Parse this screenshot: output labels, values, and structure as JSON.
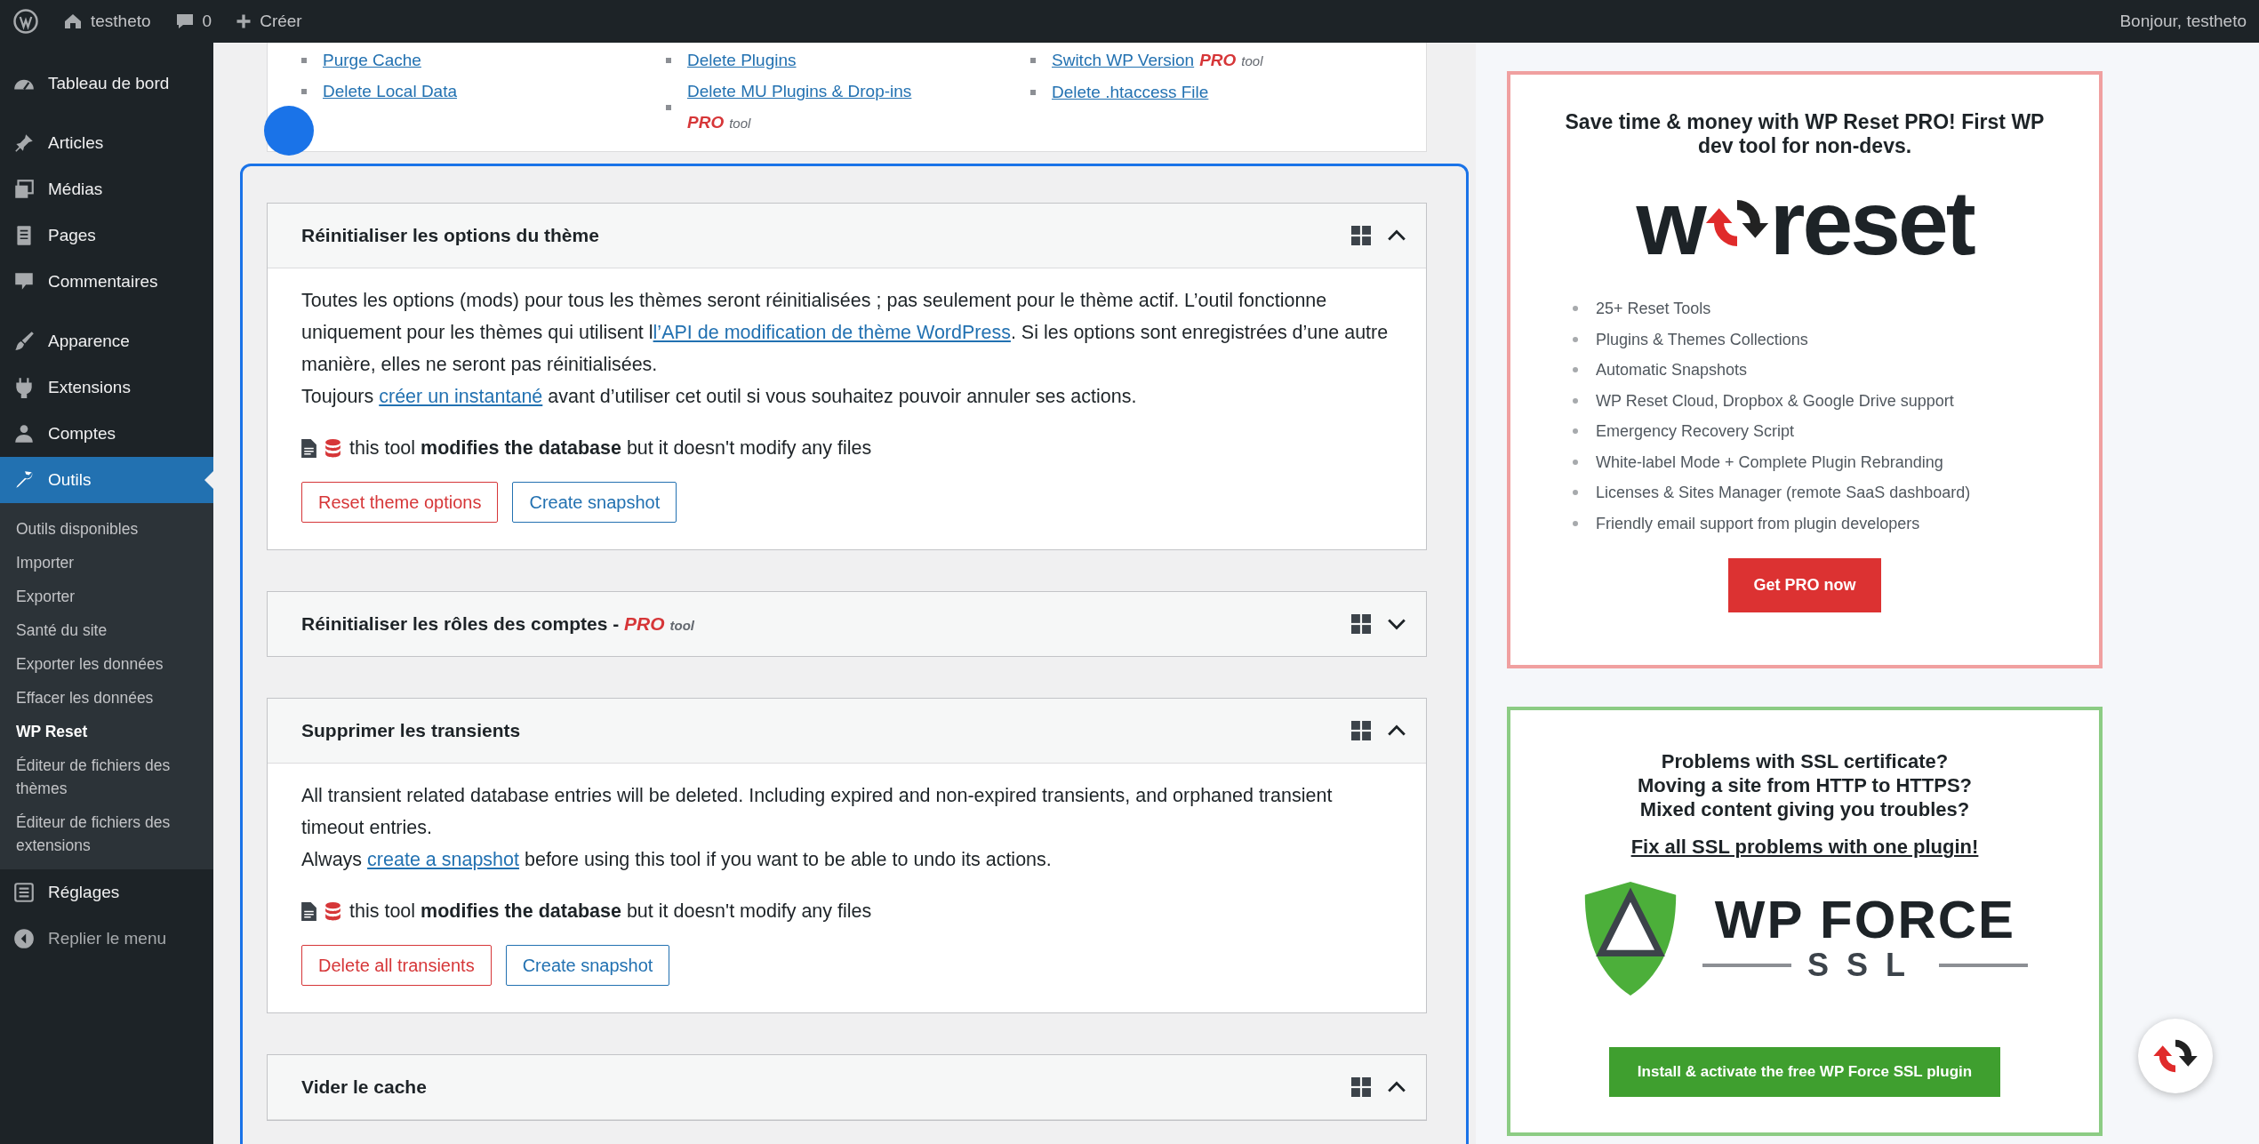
{
  "admin_bar": {
    "site": "testheto",
    "comments": "0",
    "new": "Créer",
    "greeting": "Bonjour, testheto"
  },
  "sidebar": {
    "items": [
      {
        "label": "Tableau de bord",
        "selected": false
      },
      {
        "label": "Articles",
        "selected": false
      },
      {
        "label": "Médias",
        "selected": false
      },
      {
        "label": "Pages",
        "selected": false
      },
      {
        "label": "Commentaires",
        "selected": false
      },
      {
        "label": "Apparence",
        "selected": false
      },
      {
        "label": "Extensions",
        "selected": false
      },
      {
        "label": "Comptes",
        "selected": false
      },
      {
        "label": "Outils",
        "selected": true,
        "children": [
          {
            "label": "Outils disponibles",
            "selected": false
          },
          {
            "label": "Importer",
            "selected": false
          },
          {
            "label": "Exporter",
            "selected": false
          },
          {
            "label": "Santé du site",
            "selected": false
          },
          {
            "label": "Exporter les données",
            "selected": false
          },
          {
            "label": "Effacer les données",
            "selected": false
          },
          {
            "label": "WP Reset",
            "selected": true
          },
          {
            "label": "Éditeur de fichiers des thèmes",
            "selected": false
          },
          {
            "label": "Éditeur de fichiers des extensions",
            "selected": false
          }
        ]
      },
      {
        "label": "Réglages",
        "selected": false
      }
    ],
    "collapse_label": "Replier le menu"
  },
  "tools_list": {
    "columns": [
      [
        {
          "label": "Purge Cache"
        },
        {
          "label": "Delete Local Data"
        }
      ],
      [
        {
          "label": "Delete Plugins"
        },
        {
          "label": "Delete MU Plugins & Drop-ins",
          "pro": "PRO",
          "pro_note": "tool"
        }
      ],
      [
        {
          "label": "Switch WP Version",
          "pro": "PRO",
          "pro_note": "tool"
        },
        {
          "label": "Delete .htaccess File"
        }
      ]
    ]
  },
  "cards": [
    {
      "title": "Réinitialiser les options du thème",
      "expanded": true,
      "paragraphs": [
        [
          {
            "kind": "text",
            "text": "Toutes les options (mods) pour tous les thèmes seront réinitialisées ; pas seulement pour le thème actif. L’outil fonctionne uniquement pour les thèmes qui utilisent l"
          },
          {
            "kind": "link",
            "text": "l’API de modification de thème WordPress"
          },
          {
            "kind": "text",
            "text": ". Si les options sont enregistrées d’une autre manière, elles ne seront pas réinitialisées."
          }
        ],
        [
          {
            "kind": "text",
            "text": "Toujours "
          },
          {
            "kind": "link",
            "text": "créer un instantané"
          },
          {
            "kind": "text",
            "text": " avant d’utiliser cet outil si vous souhaitez pouvoir annuler ses actions."
          }
        ]
      ],
      "note": "this tool **modifies the database** but it doesn't modify any files",
      "buttons": [
        {
          "label": "Reset theme options",
          "kind": "danger"
        },
        {
          "label": "Create snapshot",
          "kind": "secondary"
        }
      ]
    },
    {
      "title": "Réinitialiser les rôles des comptes - ",
      "pro": "PRO",
      "pro_note": "tool",
      "expanded": false
    },
    {
      "title": "Supprimer les transients",
      "expanded": true,
      "paragraphs": [
        [
          {
            "kind": "text",
            "text": "All transient related database entries will be deleted. Including expired and non-expired transients, and orphaned transient timeout entries."
          }
        ],
        [
          {
            "kind": "text",
            "text": "Always "
          },
          {
            "kind": "link",
            "text": "create a snapshot"
          },
          {
            "kind": "text",
            "text": " before using this tool if you want to be able to undo its actions."
          }
        ]
      ],
      "note": "this tool **modifies the database** but it doesn't modify any files",
      "buttons": [
        {
          "label": "Delete all transients",
          "kind": "danger"
        },
        {
          "label": "Create snapshot",
          "kind": "secondary"
        }
      ]
    },
    {
      "title": "Vider le cache",
      "expanded": true
    }
  ],
  "promos": [
    {
      "kind": "reset",
      "heading": "Save time & money with WP Reset PRO! First WP dev tool for non-devs.",
      "logo_prefix": "w",
      "logo": "reset",
      "features": [
        "25+ Reset Tools",
        "Plugins & Themes Collections",
        "Automatic Snapshots",
        "WP Reset Cloud, Dropbox & Google Drive support",
        "Emergency Recovery Script",
        "White-label Mode + Complete Plugin Rebranding",
        "Licenses & Sites Manager (remote SaaS dashboard)",
        "Friendly email support from plugin developers"
      ],
      "button": "Get PRO now"
    },
    {
      "kind": "ssl",
      "heading_lines": [
        "Problems with SSL certificate?",
        "Moving a site from HTTP to HTTPS?",
        "Mixed content giving you troubles?"
      ],
      "link": "Fix all SSL problems with one plugin!",
      "logo_top": "WP FORCE",
      "logo_bottom": "SSL",
      "button": "Install & activate the free WP Force SSL plugin"
    }
  ]
}
